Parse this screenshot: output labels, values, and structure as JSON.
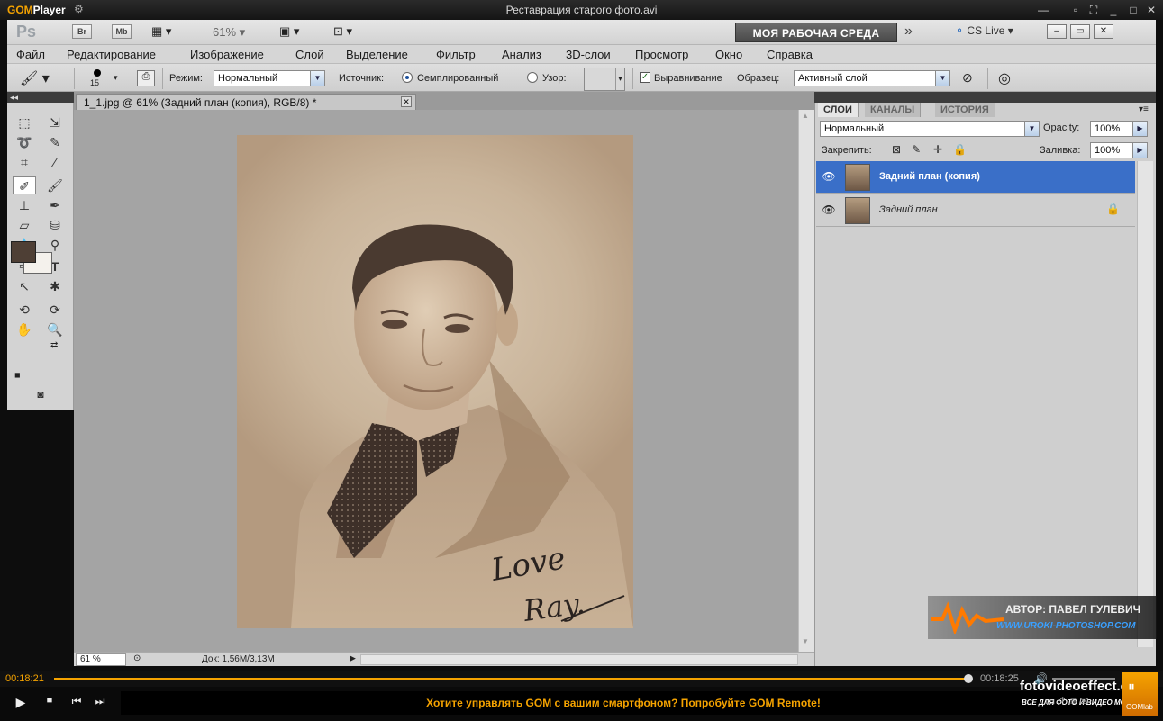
{
  "gom": {
    "logo_brand": "GOM",
    "logo_suffix": "Player",
    "filename": "Реставрация старого фото.avi",
    "time_current": "00:18:21",
    "time_total": "00:18:25",
    "ticker": "Хотите управлять GOM с вашим смартфоном? Попробуйте GOM Remote!",
    "gomlab": "GOMlab"
  },
  "ps": {
    "logo": "Ps",
    "bridge": "Br",
    "minibridge": "Mb",
    "zoom": "61%",
    "workspace": "МОЯ РАБОЧАЯ СРЕДА",
    "cslive": "CS Live"
  },
  "menu": [
    "Файл",
    "Редактирование",
    "Изображение",
    "Слой",
    "Выделение",
    "Фильтр",
    "Анализ",
    "3D-слои",
    "Просмотр",
    "Окно",
    "Справка"
  ],
  "options": {
    "brush_size": "15",
    "mode_label": "Режим:",
    "mode_value": "Нормальный",
    "source_label": "Источник:",
    "source_sampled": "Семплированный",
    "source_pattern": "Узор:",
    "aligned": "Выравнивание",
    "sample_label": "Образец:",
    "sample_value": "Активный слой"
  },
  "document": {
    "tab": "1_1.jpg @ 61% (Задний план (копия), RGB/8) *",
    "zoom": "61 %",
    "docinfo": "Док: 1,56M/3,13M"
  },
  "photo": {
    "inscription_1": "Love",
    "inscription_2": "Ray."
  },
  "panel": {
    "tabs": [
      "СЛОИ",
      "КАНАЛЫ",
      "ИСТОРИЯ"
    ],
    "blend": "Нормальный",
    "opacity_label": "Opacity:",
    "opacity": "100%",
    "lock_label": "Закрепить:",
    "fill_label": "Заливка:",
    "fill": "100%",
    "layers": [
      {
        "name": "Задний план (копия)",
        "selected": true
      },
      {
        "name": "Задний план",
        "selected": false
      }
    ]
  },
  "watermark": {
    "author": "АВТОР: ПАВЕЛ ГУЛЕВИЧ",
    "site": "WWW.UROKI-PHOTOSHOP.COM",
    "site2": "fotovideoeffect.com",
    "tagline": "ВСЕ ДЛЯ ФОТО И ВИДЕО МОНТАЖА!"
  },
  "colors": {
    "gom_accent": "#f5a300",
    "selection": "#3a6fc8",
    "foreground": "#4e3f35",
    "background": "#f4f1ec"
  }
}
